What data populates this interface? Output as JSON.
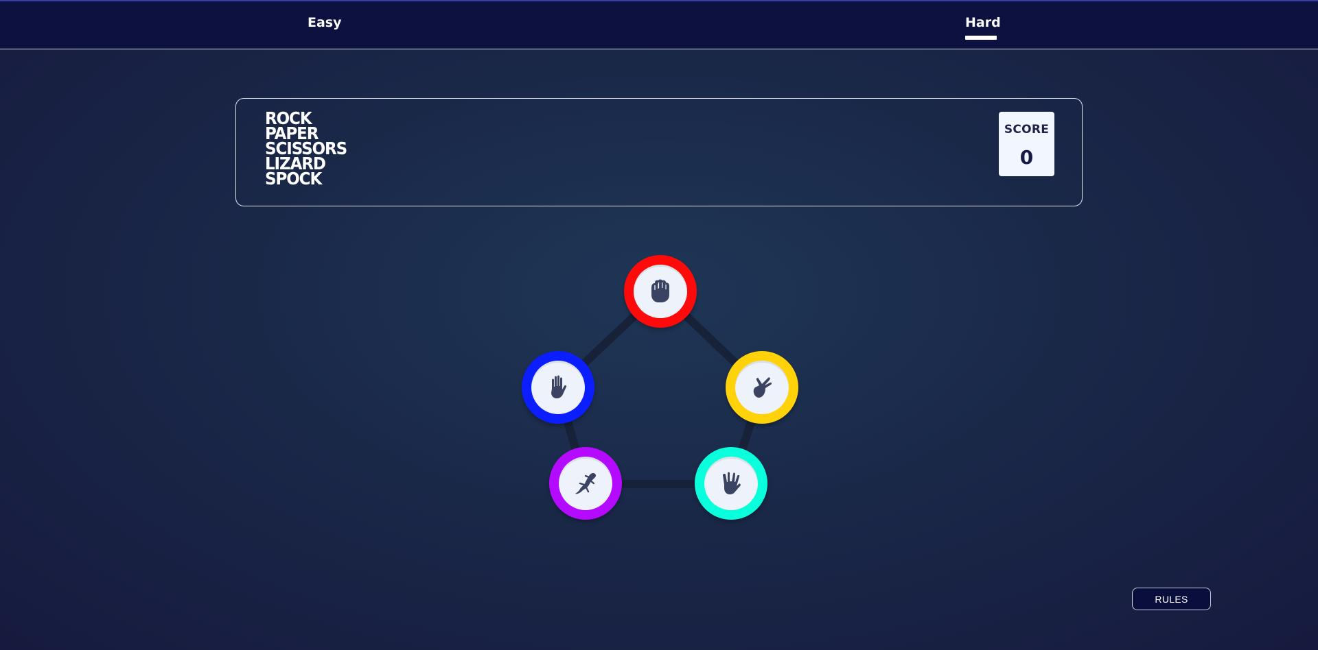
{
  "nav": {
    "tabs": [
      {
        "label": "Easy",
        "active": false
      },
      {
        "label": "Hard",
        "active": true
      }
    ]
  },
  "header": {
    "title_lines": [
      "ROCK",
      "PAPER",
      "SCISSORS",
      "LIZARD",
      "SPOCK"
    ],
    "score_label": "SCORE",
    "score_value": "0"
  },
  "choices": [
    {
      "name": "rock",
      "icon": "fist-icon",
      "color": "#ff0a0a"
    },
    {
      "name": "paper",
      "icon": "open-hand-icon",
      "color": "#0a1eff"
    },
    {
      "name": "scissors",
      "icon": "peace-hand-icon",
      "color": "#ffd20a"
    },
    {
      "name": "lizard",
      "icon": "lizard-icon",
      "color": "#b40aff"
    },
    {
      "name": "spock",
      "icon": "vulcan-hand-icon",
      "color": "#0affdc"
    }
  ],
  "rules_button": "RULES",
  "colors": {
    "nav_bg": "#0c1140",
    "icon_fill": "#3b4363",
    "pentagon_line": "#172238"
  }
}
